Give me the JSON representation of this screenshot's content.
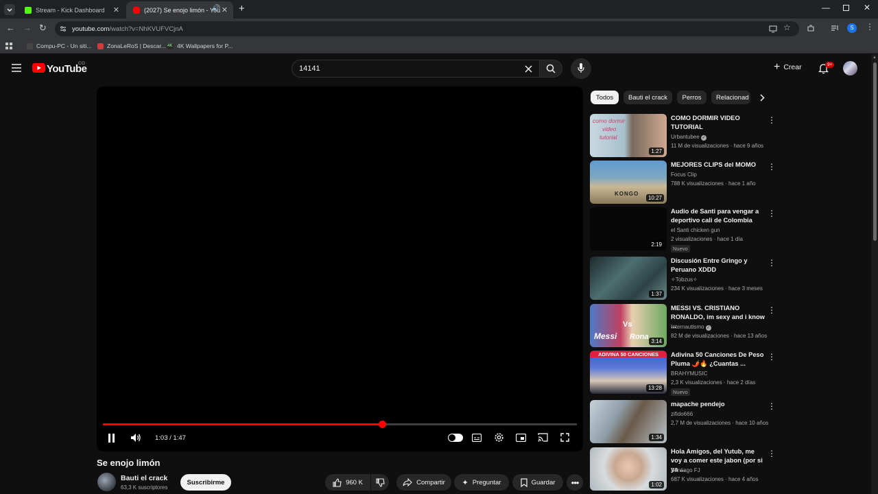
{
  "browser": {
    "tabs": [
      {
        "label": "Stream - Kick Dashboard",
        "favicon_color": "#53fc18"
      },
      {
        "label": "(2027) Se enojo limón - You",
        "favicon_color": "#ff0000"
      }
    ],
    "url_host": "youtube.com",
    "url_path": "/watch?v=NhKVUFVCjnA",
    "bookmarks": [
      "Compu-PC - Un siti...",
      "ZonaLeRoS | Descar...",
      "4K Wallpapers for P..."
    ],
    "profile_letter": "S"
  },
  "masthead": {
    "logo_text": "YouTube",
    "country_code": "CO",
    "search_value": "14141",
    "create_label": "Crear",
    "notifications_badge": "9+"
  },
  "player": {
    "time_label": "1:03 / 1:47",
    "progress_fraction": 0.589
  },
  "video": {
    "title": "Se enojo limón",
    "channel_name": "Bauti el crack",
    "subscribers": "63,3 K suscriptores",
    "subscribe_label": "Suscribirme",
    "likes": "960 K",
    "share_label": "Compartir",
    "ask_label": "Preguntar",
    "save_label": "Guardar"
  },
  "chips": [
    "Todos",
    "Bauti el crack",
    "Perros",
    "Relacionad"
  ],
  "recommendations": [
    {
      "title": "COMO DORMIR VIDEO TUTORIAL",
      "channel": "Urbantubee",
      "verified": true,
      "meta": "11 M de visualizaciones · hace 9 años",
      "duration": "1:27",
      "badge": "",
      "thumb_color": "#7a98a8"
    },
    {
      "title": "MEJORES CLIPS del MOMO",
      "channel": "Focus Clip",
      "verified": false,
      "meta": "788 K visualizaciones · hace 1 año",
      "duration": "10:27",
      "badge": "",
      "thumb_color": "#4f7fa0"
    },
    {
      "title": "Audio de Santi para vengar a deportivo cali de Colombia",
      "channel": "el Santi chicken gun",
      "verified": false,
      "meta": "2 visualizaciones · hace 1 día",
      "duration": "2:19",
      "badge": "Nuevo",
      "thumb_color": "#050505"
    },
    {
      "title": "Discusión Entre Gringo y Peruano XDDD",
      "channel": "✧Tobzus✧",
      "verified": false,
      "meta": "234 K visualizaciones · hace 3 meses",
      "duration": "1:37",
      "badge": "",
      "thumb_color": "#3c5a5c"
    },
    {
      "title": "MESSI VS. CRISTIANO RONALDO, im sexy and i know ...",
      "channel": "Internautismo",
      "verified": true,
      "meta": "82 M de visualizaciones · hace 13 años",
      "duration": "3:14",
      "badge": "",
      "thumb_color": "#c86a3c"
    },
    {
      "title": "Adivina 50 Canciones De Peso Pluma 🌶️🔥 ¿Cuantas ...",
      "channel": "BRAHYMUSIC",
      "verified": false,
      "meta": "2,3 K visualizaciones · hace 2 días",
      "duration": "13:28",
      "badge": "Nuevo",
      "thumb_color": "#3a58c8"
    },
    {
      "title": "mapache pendejo",
      "channel": "zifido666",
      "verified": false,
      "meta": "2,7 M de visualizaciones · hace 10 años",
      "duration": "1:34",
      "badge": "",
      "thumb_color": "#8a9aa6"
    },
    {
      "title": "Hola Amigos, del Yutub, me voy a comer este jabon (por si ya ...",
      "channel": "Santiago FJ",
      "verified": false,
      "meta": "687 K visualizaciones · hace 4 años",
      "duration": "1:02",
      "badge": "",
      "thumb_color": "#b8bcc0"
    }
  ],
  "thumb_captions": {
    "r0": [
      "como dormir",
      "video",
      "tutorial"
    ],
    "r1": "KONGO",
    "r4": [
      "Messi",
      "Vs",
      "Rona"
    ],
    "r5": "ADIVINA 50 CANCIONES"
  }
}
